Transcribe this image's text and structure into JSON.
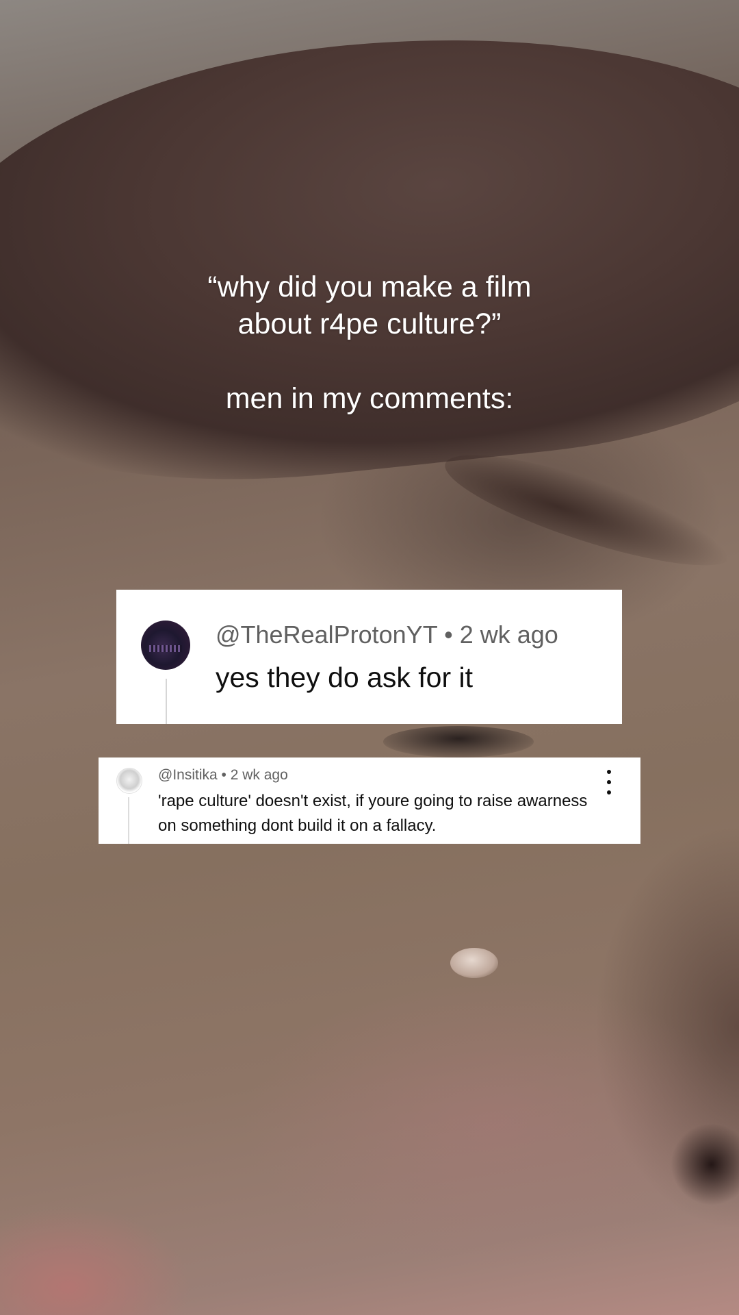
{
  "caption": {
    "line1": "“why did you make a film",
    "line2": "about r4pe culture?”",
    "line3": "men in my comments:"
  },
  "comment1": {
    "handle": "@TheRealProtonYT",
    "separator": "•",
    "time": "2 wk ago",
    "text": "yes they do ask for it"
  },
  "comment2": {
    "handle": "@Insitika",
    "separator": "•",
    "time": "2 wk ago",
    "text": "'rape culture' doesn't exist, if youre going to raise awarness on something dont build it on a fallacy."
  },
  "icons": {
    "comment2_menu": "more-vert-icon"
  }
}
